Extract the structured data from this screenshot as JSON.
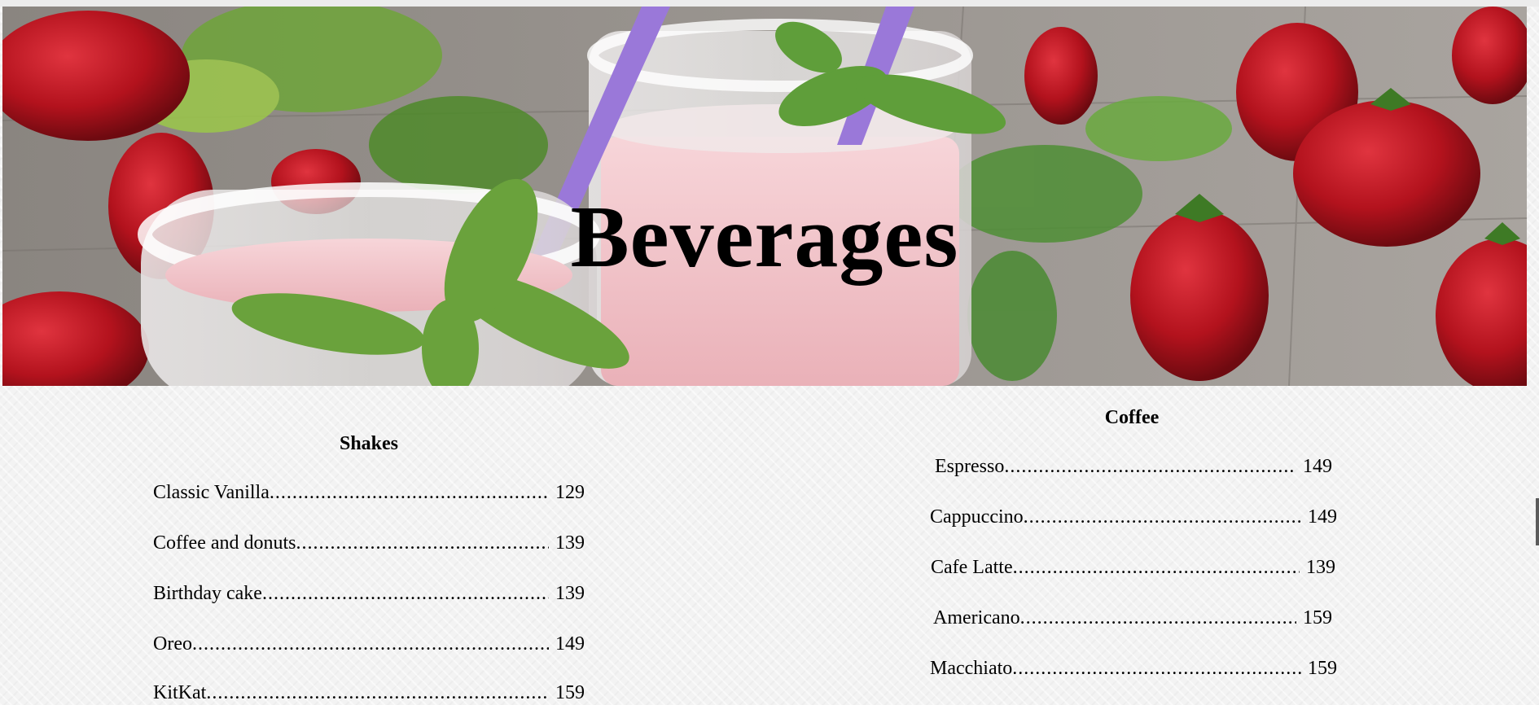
{
  "hero": {
    "title": "Beverages",
    "image": "strawberry-smoothie-jars-photo"
  },
  "sections": [
    {
      "heading": "Shakes",
      "items": [
        {
          "name": "Classic Vanilla",
          "price": "129"
        },
        {
          "name": "Coffee and donuts",
          "price": "139"
        },
        {
          "name": "Birthday cake",
          "price": "139"
        },
        {
          "name": "Oreo",
          "price": "149"
        },
        {
          "name": "KitKat",
          "price": "159"
        }
      ]
    },
    {
      "heading": "Coffee",
      "items": [
        {
          "name": "Espresso",
          "price": "149"
        },
        {
          "name": "Cappuccino",
          "price": "149"
        },
        {
          "name": "Cafe Latte",
          "price": "139"
        },
        {
          "name": "Americano",
          "price": "159"
        },
        {
          "name": "Macchiato",
          "price": "159"
        }
      ]
    }
  ]
}
